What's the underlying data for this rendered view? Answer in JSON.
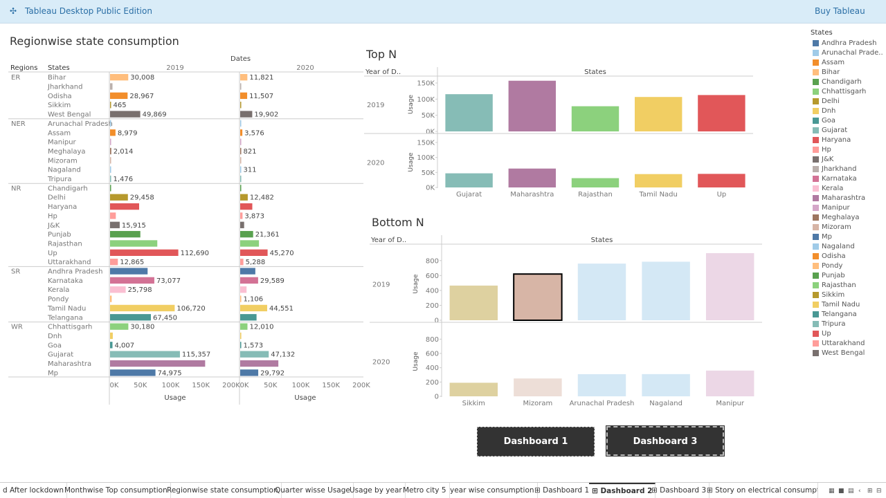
{
  "app": {
    "title": "Tableau Desktop Public Edition",
    "buy": "Buy Tableau"
  },
  "colors": {
    "Andhra Pradesh": "#4e79a7",
    "Arunachal Pradesh": "#a0cbe8",
    "Assam": "#f28e2b",
    "Bihar": "#ffbe7d",
    "Chandigarh": "#59a14f",
    "Chhattisgarh": "#8cd17d",
    "Delhi": "#b6992d",
    "Dnh": "#f1ce63",
    "Goa": "#499894",
    "Gujarat": "#86bcb6",
    "Haryana": "#e15759",
    "Hp": "#ff9d9a",
    "J&K": "#79706e",
    "Jharkhand": "#bab0ac",
    "Karnataka": "#d37295",
    "Kerala": "#fabfd2",
    "Maharashtra": "#b07aa1",
    "Manipur": "#d4a6c8",
    "Meghalaya": "#9d7660",
    "Mizoram": "#d7b5a6",
    "Mp": "#4e79a7",
    "Nagaland": "#a0cbe8",
    "Odisha": "#f28e2b",
    "Pondy": "#ffbe7d",
    "Punjab": "#59a14f",
    "Rajasthan": "#8cd17d",
    "Sikkim": "#b6992d",
    "Tamil Nadu": "#f1ce63",
    "Telangana": "#499894",
    "Tripura": "#86bcb6",
    "Up": "#e15759",
    "Uttarakhand": "#ff9d9a",
    "West Bengal": "#79706e"
  },
  "regionwise": {
    "title": "Regionwise state consumption",
    "dates_label": "Dates",
    "col_regions": "Regions",
    "col_states": "States",
    "years": [
      "2019",
      "2020"
    ],
    "x_ticks": [
      "0K",
      "50K",
      "100K",
      "150K",
      "200K"
    ],
    "x_label": "Usage"
  },
  "topn": {
    "title": "Top N",
    "col_year": "Year of D..",
    "col_states": "States",
    "y_label": "Usage",
    "y_ticks": [
      "0K",
      "50K",
      "100K",
      "150K"
    ]
  },
  "bottomn": {
    "title": "Bottom N",
    "col_year": "Year of D..",
    "col_states": "States",
    "y_label": "Usage",
    "y_ticks": [
      "0",
      "200",
      "400",
      "600",
      "800"
    ]
  },
  "legend": {
    "title": "States",
    "items": [
      "Andhra Pradesh",
      "Arunachal Prade..",
      "Assam",
      "Bihar",
      "Chandigarh",
      "Chhattisgarh",
      "Delhi",
      "Dnh",
      "Goa",
      "Gujarat",
      "Haryana",
      "Hp",
      "J&K",
      "Jharkhand",
      "Karnataka",
      "Kerala",
      "Maharashtra",
      "Manipur",
      "Meghalaya",
      "Mizoram",
      "Mp",
      "Nagaland",
      "Odisha",
      "Pondy",
      "Punjab",
      "Rajasthan",
      "Sikkim",
      "Tamil Nadu",
      "Telangana",
      "Tripura",
      "Up",
      "Uttarakhand",
      "West Bengal"
    ]
  },
  "buttons": {
    "dashboard1": "Dashboard 1",
    "dashboard3": "Dashboard 3"
  },
  "tabs": [
    "d After lockdown",
    "Monthwise Top consumption",
    "Regionwise state consumption",
    "Quarter wisse Usage",
    "Usage by year",
    "Metro city 5",
    "year wise consumption",
    "Dashboard 1",
    "Dashboard 2",
    "Dashboard 3",
    "Story on electrical consumpti..."
  ],
  "active_tab": "Dashboard 2",
  "chart_data": [
    {
      "type": "bar",
      "title": "Regionwise state consumption",
      "xlabel": "Usage",
      "xlim": [
        0,
        200000
      ],
      "years": [
        "2019",
        "2020"
      ],
      "rows": [
        {
          "region": "ER",
          "state": "Bihar",
          "v2019": 30008,
          "v2020": 11821
        },
        {
          "region": "ER",
          "state": "Jharkhand",
          "v2019": 4000,
          "v2020": 1200
        },
        {
          "region": "ER",
          "state": "Odisha",
          "v2019": 28967,
          "v2020": 11507
        },
        {
          "region": "ER",
          "state": "Sikkim",
          "v2019": 465,
          "v2020": 150
        },
        {
          "region": "ER",
          "state": "West Bengal",
          "v2019": 49869,
          "v2020": 19902
        },
        {
          "region": "NER",
          "state": "Arunachal Pradesh",
          "v2019": 700,
          "v2020": 300
        },
        {
          "region": "NER",
          "state": "Assam",
          "v2019": 8979,
          "v2020": 3576
        },
        {
          "region": "NER",
          "state": "Manipur",
          "v2019": 900,
          "v2020": 400
        },
        {
          "region": "NER",
          "state": "Meghalaya",
          "v2019": 2014,
          "v2020": 821
        },
        {
          "region": "NER",
          "state": "Mizoram",
          "v2019": 600,
          "v2020": 250
        },
        {
          "region": "NER",
          "state": "Nagaland",
          "v2019": 800,
          "v2020": 311
        },
        {
          "region": "NER",
          "state": "Tripura",
          "v2019": 1476,
          "v2020": 600
        },
        {
          "region": "NR",
          "state": "Chandigarh",
          "v2019": 1500,
          "v2020": 600
        },
        {
          "region": "NR",
          "state": "Delhi",
          "v2019": 29458,
          "v2020": 12482
        },
        {
          "region": "NR",
          "state": "Haryana",
          "v2019": 48000,
          "v2020": 20000
        },
        {
          "region": "NR",
          "state": "Hp",
          "v2019": 9500,
          "v2020": 3873
        },
        {
          "region": "NR",
          "state": "J&K",
          "v2019": 15915,
          "v2020": 6500
        },
        {
          "region": "NR",
          "state": "Punjab",
          "v2019": 50000,
          "v2020": 21361
        },
        {
          "region": "NR",
          "state": "Rajasthan",
          "v2019": 78000,
          "v2020": 31000
        },
        {
          "region": "NR",
          "state": "Up",
          "v2019": 112690,
          "v2020": 45270
        },
        {
          "region": "NR",
          "state": "Uttarakhand",
          "v2019": 12865,
          "v2020": 5288
        },
        {
          "region": "SR",
          "state": "Andhra Pradesh",
          "v2019": 62000,
          "v2020": 25000
        },
        {
          "region": "SR",
          "state": "Karnataka",
          "v2019": 73077,
          "v2020": 29589
        },
        {
          "region": "SR",
          "state": "Kerala",
          "v2019": 25798,
          "v2020": 10500
        },
        {
          "region": "SR",
          "state": "Pondy",
          "v2019": 2700,
          "v2020": 1106
        },
        {
          "region": "SR",
          "state": "Tamil Nadu",
          "v2019": 106720,
          "v2020": 44551
        },
        {
          "region": "SR",
          "state": "Telangana",
          "v2019": 67450,
          "v2020": 27000
        },
        {
          "region": "WR",
          "state": "Chhattisgarh",
          "v2019": 30180,
          "v2020": 12010
        },
        {
          "region": "WR",
          "state": "Dnh",
          "v2019": 4500,
          "v2020": 1800
        },
        {
          "region": "WR",
          "state": "Goa",
          "v2019": 4007,
          "v2020": 1573
        },
        {
          "region": "WR",
          "state": "Gujarat",
          "v2019": 115357,
          "v2020": 47132
        },
        {
          "region": "WR",
          "state": "Maharashtra",
          "v2019": 157000,
          "v2020": 63000
        },
        {
          "region": "WR",
          "state": "Mp",
          "v2019": 74975,
          "v2020": 29792
        }
      ]
    },
    {
      "type": "bar",
      "title": "Top N",
      "ylabel": "Usage",
      "ylim": [
        0,
        150000
      ],
      "categories": [
        "Gujarat",
        "Maharashtra",
        "Rajasthan",
        "Tamil Nadu",
        "Up"
      ],
      "series": [
        {
          "name": "2019",
          "values": [
            115357,
            157000,
            78000,
            106720,
            112690
          ]
        },
        {
          "name": "2020",
          "values": [
            47132,
            63000,
            31000,
            44551,
            45270
          ]
        }
      ]
    },
    {
      "type": "bar",
      "title": "Bottom N",
      "ylabel": "Usage",
      "ylim": [
        0,
        900
      ],
      "categories": [
        "Sikkim",
        "Mizoram",
        "Arunachal Pradesh",
        "Nagaland",
        "Manipur"
      ],
      "series": [
        {
          "name": "2019",
          "values": [
            465,
            620,
            760,
            785,
            900
          ]
        },
        {
          "name": "2020",
          "values": [
            190,
            250,
            310,
            311,
            360
          ]
        }
      ]
    }
  ]
}
